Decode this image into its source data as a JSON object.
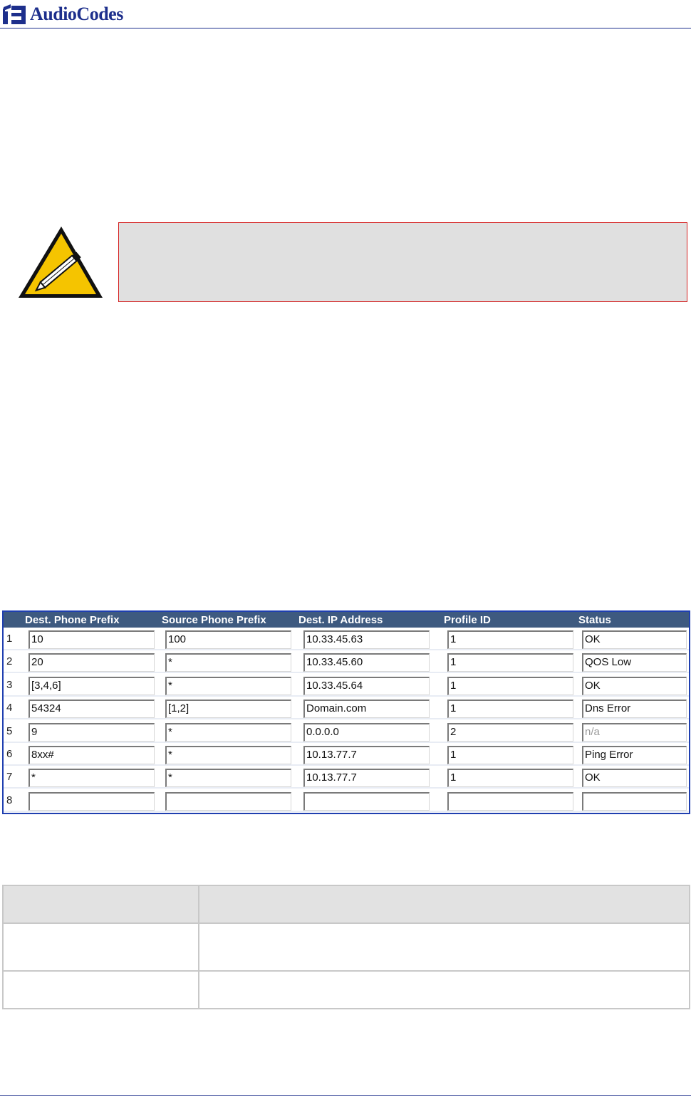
{
  "header": {
    "brand": "AudioCodes",
    "logo_icon": "audiocodes-logo-icon",
    "brand_color": "#1d2f8c"
  },
  "note": {
    "icon": "note-pencil-warning-icon",
    "border_color": "#d42020"
  },
  "routing_table": {
    "header_color": "#3e5a80",
    "columns": [
      "Dest. Phone Prefix",
      "Source Phone Prefix",
      "Dest. IP Address",
      "Profile ID",
      "Status"
    ],
    "rows": [
      {
        "index": "1",
        "dest_prefix": "10",
        "source_prefix": "100",
        "dest_ip": "10.33.45.63",
        "profile_id": "1",
        "status": "OK"
      },
      {
        "index": "2",
        "dest_prefix": "20",
        "source_prefix": "*",
        "dest_ip": "10.33.45.60",
        "profile_id": "1",
        "status": "QOS Low"
      },
      {
        "index": "3",
        "dest_prefix": "[3,4,6]",
        "source_prefix": "*",
        "dest_ip": "10.33.45.64",
        "profile_id": "1",
        "status": "OK"
      },
      {
        "index": "4",
        "dest_prefix": "54324",
        "source_prefix": "[1,2]",
        "dest_ip": "Domain.com",
        "profile_id": "1",
        "status": "Dns Error"
      },
      {
        "index": "5",
        "dest_prefix": "9",
        "source_prefix": "*",
        "dest_ip": "0.0.0.0",
        "profile_id": "2",
        "status": "n/a"
      },
      {
        "index": "6",
        "dest_prefix": "8xx#",
        "source_prefix": "*",
        "dest_ip": "10.13.77.7",
        "profile_id": "1",
        "status": "Ping Error"
      },
      {
        "index": "7",
        "dest_prefix": "*",
        "source_prefix": "*",
        "dest_ip": "10.13.77.7",
        "profile_id": "1",
        "status": "OK"
      },
      {
        "index": "8",
        "dest_prefix": "",
        "source_prefix": "",
        "dest_ip": "",
        "profile_id": "",
        "status": ""
      }
    ]
  }
}
